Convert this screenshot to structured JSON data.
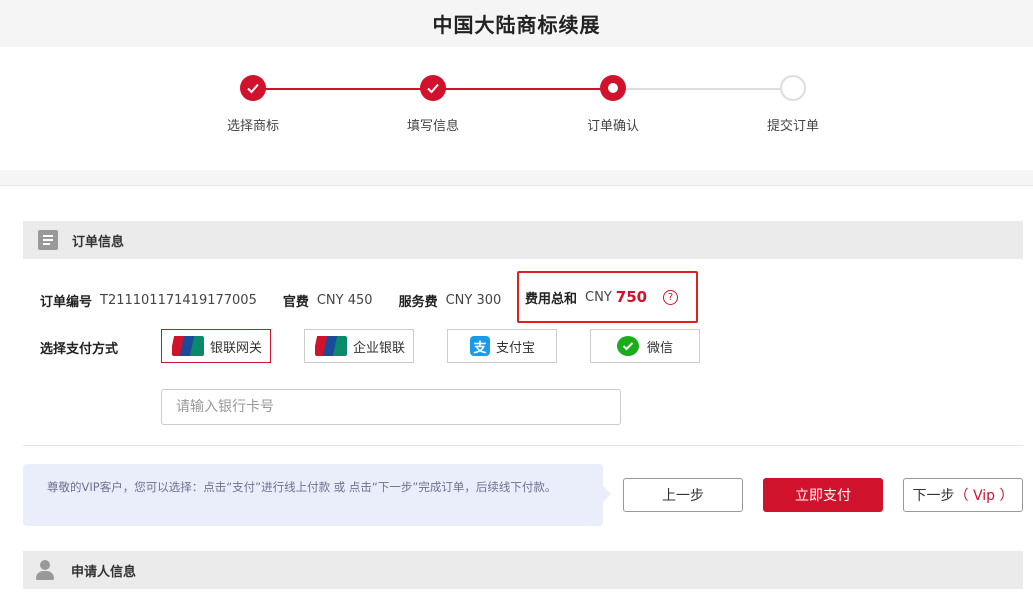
{
  "header": {
    "title": "中国大陆商标续展"
  },
  "steps": [
    {
      "label": "选择商标",
      "state": "done"
    },
    {
      "label": "填写信息",
      "state": "done"
    },
    {
      "label": "订单确认",
      "state": "current"
    },
    {
      "label": "提交订单",
      "state": "todo"
    }
  ],
  "order_section": {
    "title": "订单信息",
    "icon": "document-icon"
  },
  "order": {
    "number_label": "订单编号",
    "number_value": "T211101171419177005",
    "official_fee_label": "官费",
    "official_fee_value": "CNY 450",
    "service_fee_label": "服务费",
    "service_fee_value": "CNY 300",
    "total_label": "费用总和",
    "total_currency": "CNY",
    "total_amount": "750",
    "help_symbol": "?"
  },
  "payment": {
    "label": "选择支付方式",
    "options": [
      {
        "label": "银联网关",
        "icon": "unionpay-icon",
        "selected": true
      },
      {
        "label": "企业银联",
        "icon": "unionpay-icon",
        "selected": false
      },
      {
        "label": "支付宝",
        "icon": "alipay-icon",
        "selected": false
      },
      {
        "label": "微信",
        "icon": "wechat-icon",
        "selected": false
      }
    ],
    "alipay_glyph": "支",
    "card_placeholder": "请输入银行卡号"
  },
  "tip": {
    "text": "尊敬的VIP客户，您可以选择：点击“支付”进行线上付款 或 点击“下一步”完成订单，后续线下付款。"
  },
  "buttons": {
    "prev": "上一步",
    "pay_now": "立即支付",
    "next": "下一步",
    "next_vip": "（ Vip ）"
  },
  "applicant_section": {
    "title": "申请人信息",
    "icon": "user-icon"
  },
  "colors": {
    "accent": "#d0122c",
    "step_line_done": "#d0122c",
    "step_line_todo": "#dddddd"
  }
}
